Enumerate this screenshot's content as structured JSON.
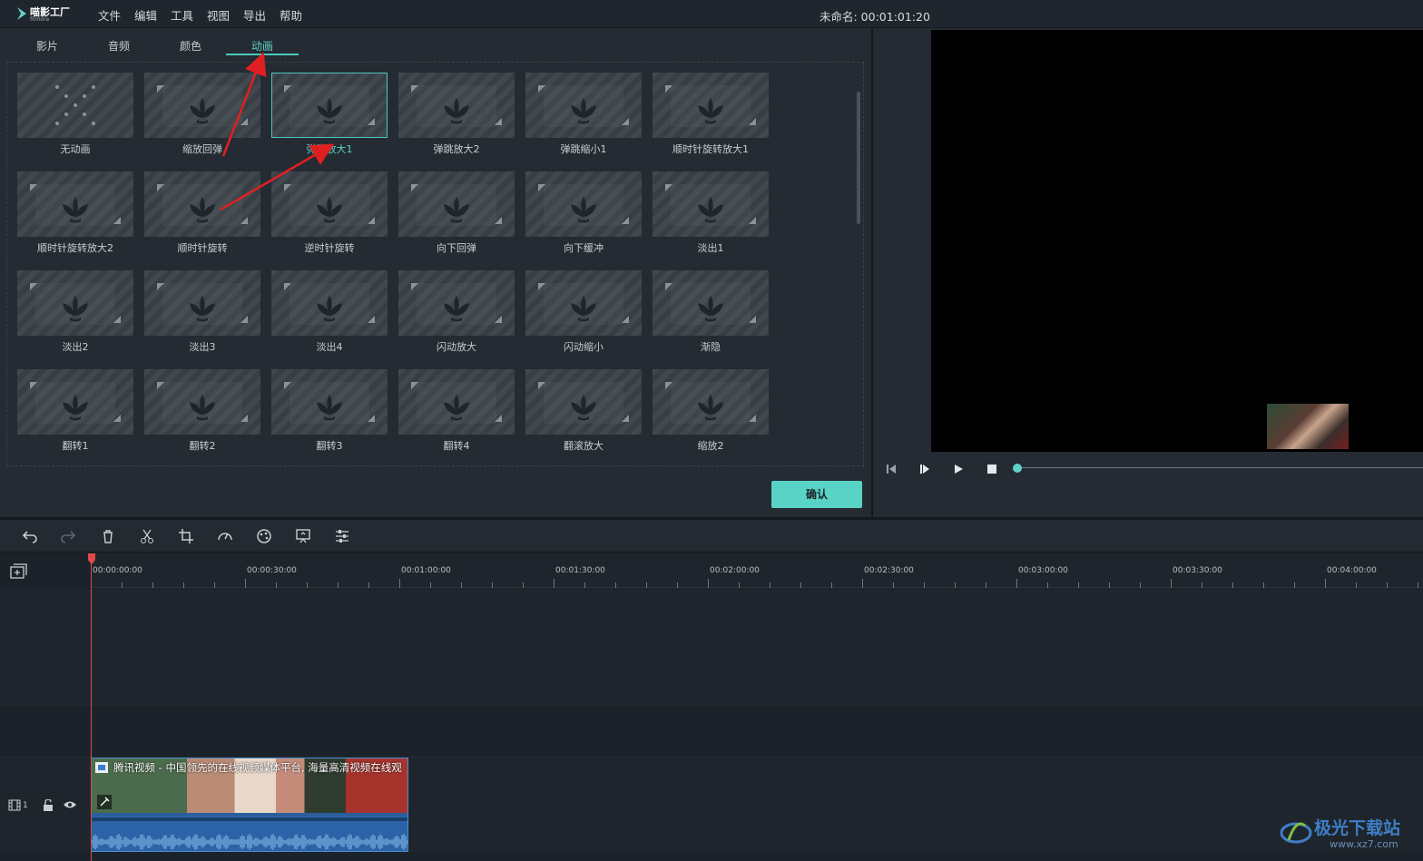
{
  "app": {
    "name": "喵影工厂",
    "sub": "filmora"
  },
  "menu": [
    "文件",
    "编辑",
    "工具",
    "视图",
    "导出",
    "帮助"
  ],
  "project": "未命名: 00:01:01:20",
  "tabs": [
    {
      "label": "影片",
      "active": false
    },
    {
      "label": "音频",
      "active": false
    },
    {
      "label": "颜色",
      "active": false
    },
    {
      "label": "动画",
      "active": true
    }
  ],
  "animations": [
    {
      "label": "无动画",
      "icon": "dots-x-icon"
    },
    {
      "label": "缩放回弹",
      "icon": "zoom-bounce-icon"
    },
    {
      "label": "弹跳放大1",
      "icon": "bounce-zoom-icon",
      "selected": true
    },
    {
      "label": "弹跳放大2",
      "icon": "bounce-zoom-icon"
    },
    {
      "label": "弹跳缩小1",
      "icon": "bounce-shrink-icon"
    },
    {
      "label": "顺时针旋转放大1",
      "icon": "rotate-zoom-icon"
    },
    {
      "label": "顺时针旋转放大2",
      "icon": "rotate-cw-icon"
    },
    {
      "label": "顺时针旋转",
      "icon": "rotate-cw-icon"
    },
    {
      "label": "逆时针旋转",
      "icon": "rotate-ccw-icon"
    },
    {
      "label": "向下回弹",
      "icon": "down-bounce-icon"
    },
    {
      "label": "向下缓冲",
      "icon": "down-ease-icon"
    },
    {
      "label": "淡出1",
      "icon": "fade-up-icon"
    },
    {
      "label": "淡出2",
      "icon": "fade-down-icon"
    },
    {
      "label": "淡出3",
      "icon": "fade-left-icon"
    },
    {
      "label": "淡出4",
      "icon": "fade-right-icon"
    },
    {
      "label": "闪动放大",
      "icon": "flash-zoom-icon"
    },
    {
      "label": "闪动缩小",
      "icon": "flash-shrink-icon"
    },
    {
      "label": "渐隐",
      "icon": "fade-icon"
    },
    {
      "label": "翻转1",
      "icon": "flip-icon"
    },
    {
      "label": "翻转2",
      "icon": "flip-icon"
    },
    {
      "label": "翻转3",
      "icon": "flip-icon"
    },
    {
      "label": "翻转4",
      "icon": "flip-icon"
    },
    {
      "label": "翻滚放大",
      "icon": "roll-zoom-icon"
    },
    {
      "label": "缩放2",
      "icon": "zoom-icon"
    }
  ],
  "confirm": "确认",
  "timecodes": [
    "00:00:00:00",
    "00:00:30:00",
    "00:01:00:00",
    "00:01:30:00",
    "00:02:00:00",
    "00:02:30:00",
    "00:03:00:00",
    "00:03:30:00",
    "00:04:00:00"
  ],
  "track_label": "1",
  "clip_title": "腾讯视频 - 中国领先的在线视频媒体平台, 海量高清视频在线观",
  "watermark": {
    "title": "极光下载站",
    "url": "www.xz7.com"
  },
  "colors": {
    "accent": "#4cc9bc",
    "playhead": "#e14a4a",
    "annotation_arrow": "#e02020"
  }
}
